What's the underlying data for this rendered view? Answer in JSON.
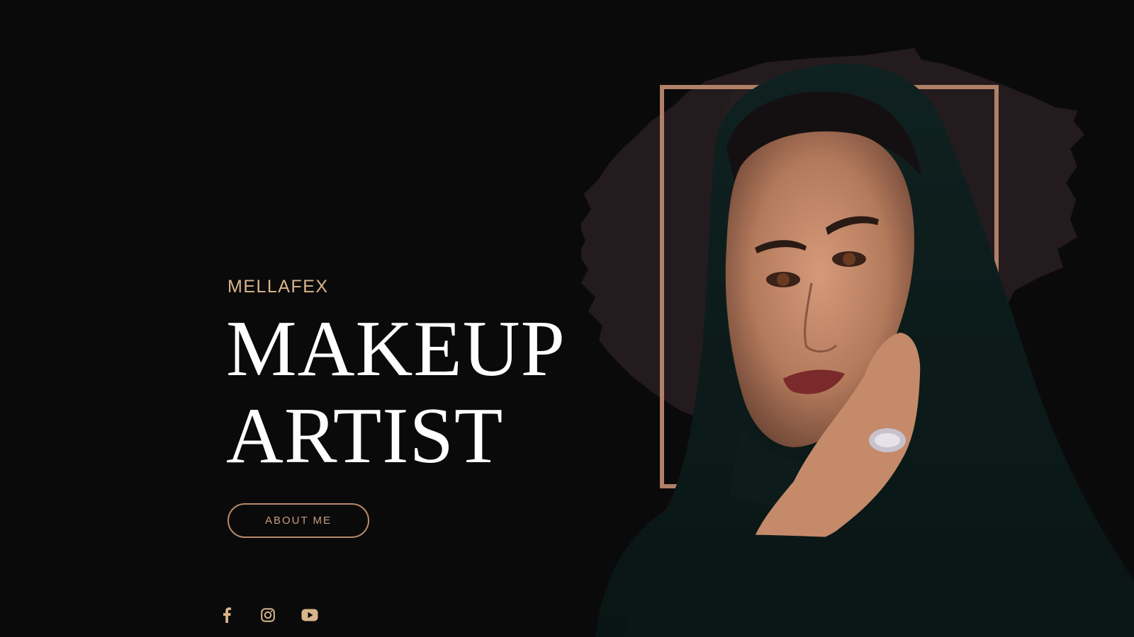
{
  "hero": {
    "brand": "MELLAFEX",
    "headline_line1": "MAKEUP",
    "headline_line2": "ARTIST",
    "button_label": "ABOUT ME"
  },
  "social": [
    {
      "icon": "facebook-icon"
    },
    {
      "icon": "instagram-icon"
    },
    {
      "icon": "youtube-icon"
    }
  ],
  "colors": {
    "background": "#0b0a0a",
    "accent": "#d9b58c",
    "button_border": "#b98a6c",
    "frame": "#b08068",
    "brush": "#231b1d",
    "headline": "#ffffff"
  }
}
